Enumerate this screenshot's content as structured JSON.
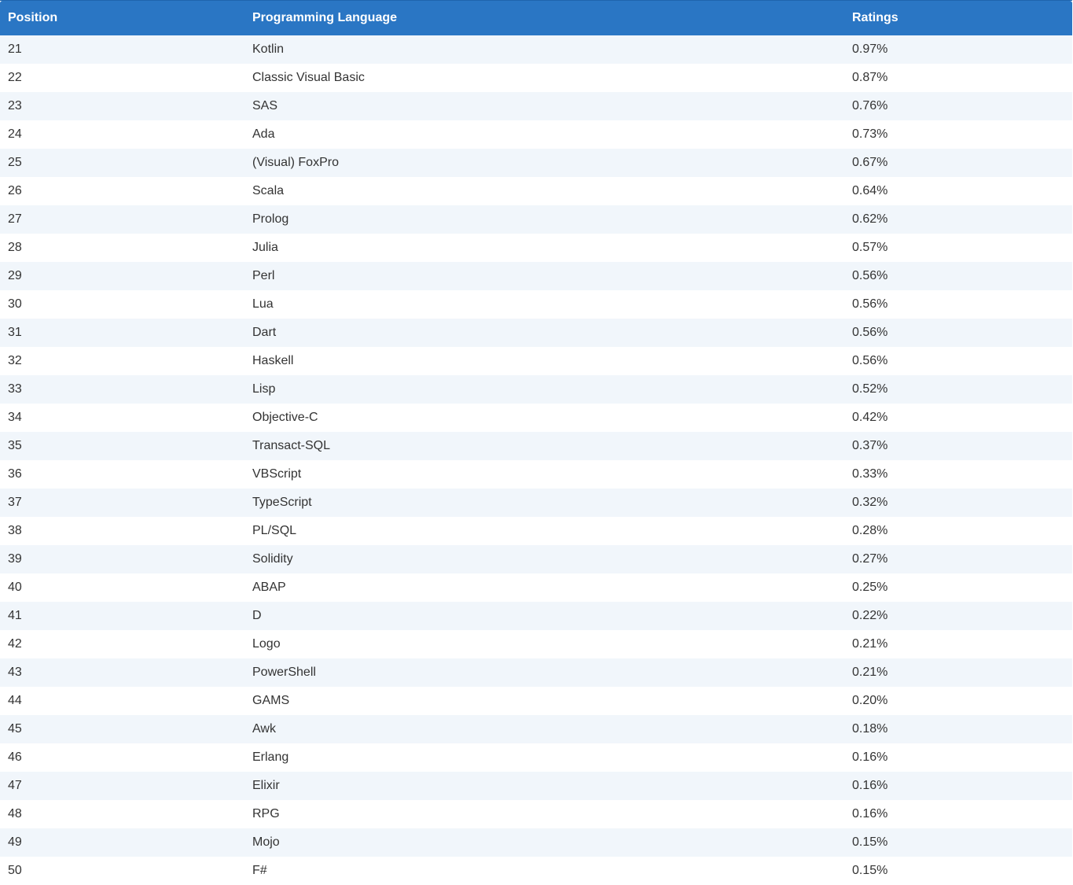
{
  "table": {
    "headers": {
      "position": "Position",
      "language": "Programming Language",
      "ratings": "Ratings"
    },
    "rows": [
      {
        "position": "21",
        "language": "Kotlin",
        "rating": "0.97%"
      },
      {
        "position": "22",
        "language": "Classic Visual Basic",
        "rating": "0.87%"
      },
      {
        "position": "23",
        "language": "SAS",
        "rating": "0.76%"
      },
      {
        "position": "24",
        "language": "Ada",
        "rating": "0.73%"
      },
      {
        "position": "25",
        "language": "(Visual) FoxPro",
        "rating": "0.67%"
      },
      {
        "position": "26",
        "language": "Scala",
        "rating": "0.64%"
      },
      {
        "position": "27",
        "language": "Prolog",
        "rating": "0.62%"
      },
      {
        "position": "28",
        "language": "Julia",
        "rating": "0.57%"
      },
      {
        "position": "29",
        "language": "Perl",
        "rating": "0.56%"
      },
      {
        "position": "30",
        "language": "Lua",
        "rating": "0.56%"
      },
      {
        "position": "31",
        "language": "Dart",
        "rating": "0.56%"
      },
      {
        "position": "32",
        "language": "Haskell",
        "rating": "0.56%"
      },
      {
        "position": "33",
        "language": "Lisp",
        "rating": "0.52%"
      },
      {
        "position": "34",
        "language": "Objective-C",
        "rating": "0.42%"
      },
      {
        "position": "35",
        "language": "Transact-SQL",
        "rating": "0.37%"
      },
      {
        "position": "36",
        "language": "VBScript",
        "rating": "0.33%"
      },
      {
        "position": "37",
        "language": "TypeScript",
        "rating": "0.32%"
      },
      {
        "position": "38",
        "language": "PL/SQL",
        "rating": "0.28%"
      },
      {
        "position": "39",
        "language": "Solidity",
        "rating": "0.27%"
      },
      {
        "position": "40",
        "language": "ABAP",
        "rating": "0.25%"
      },
      {
        "position": "41",
        "language": "D",
        "rating": "0.22%"
      },
      {
        "position": "42",
        "language": "Logo",
        "rating": "0.21%"
      },
      {
        "position": "43",
        "language": "PowerShell",
        "rating": "0.21%"
      },
      {
        "position": "44",
        "language": "GAMS",
        "rating": "0.20%"
      },
      {
        "position": "45",
        "language": "Awk",
        "rating": "0.18%"
      },
      {
        "position": "46",
        "language": "Erlang",
        "rating": "0.16%"
      },
      {
        "position": "47",
        "language": "Elixir",
        "rating": "0.16%"
      },
      {
        "position": "48",
        "language": "RPG",
        "rating": "0.16%"
      },
      {
        "position": "49",
        "language": "Mojo",
        "rating": "0.15%"
      },
      {
        "position": "50",
        "language": "F#",
        "rating": "0.15%"
      }
    ]
  }
}
